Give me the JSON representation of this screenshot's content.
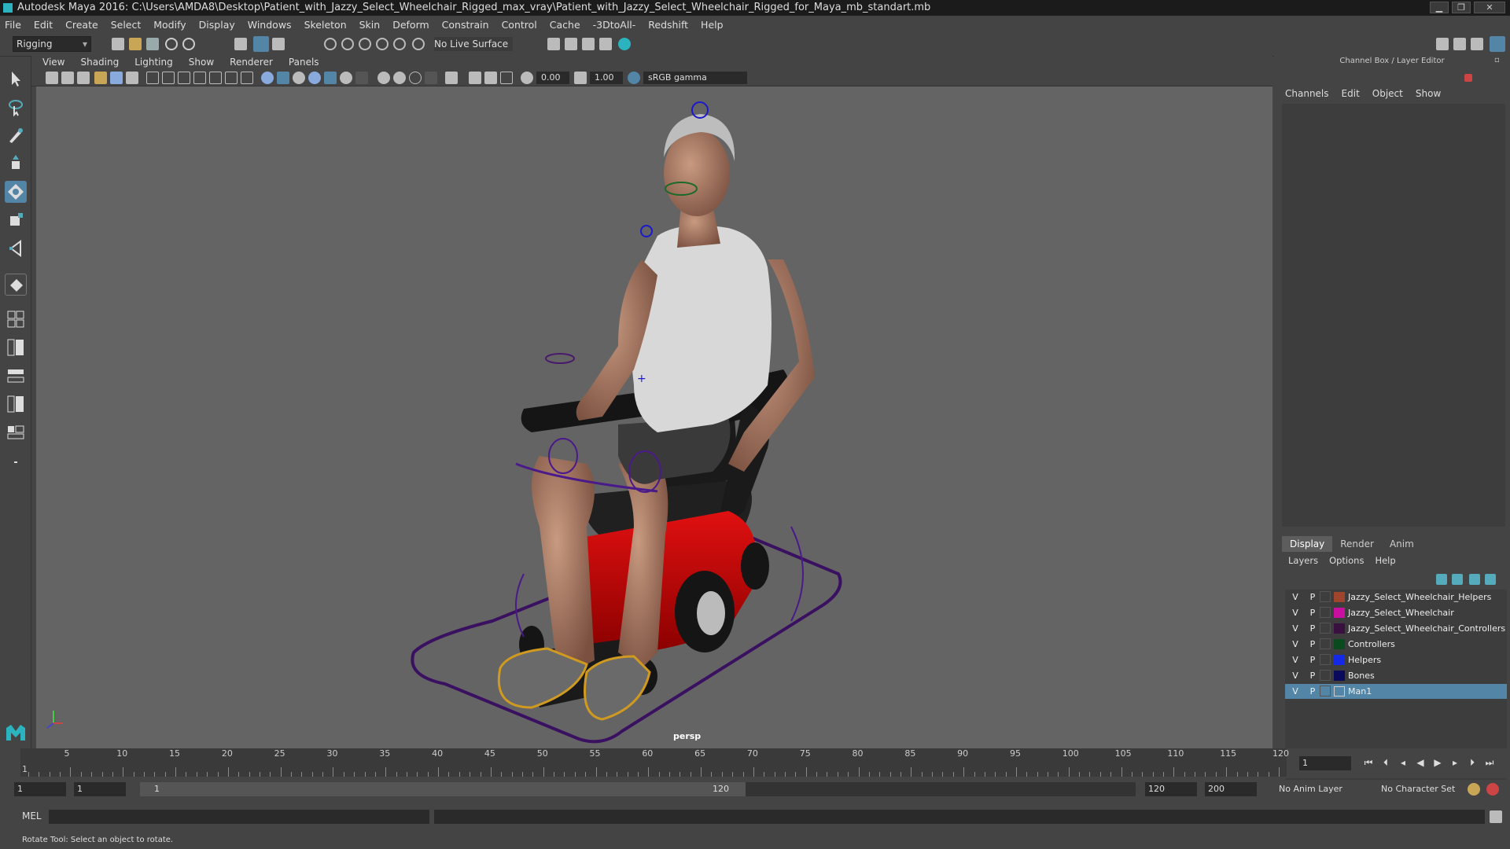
{
  "window": {
    "title": "Autodesk Maya 2016: C:\\Users\\AMDA8\\Desktop\\Patient_with_Jazzy_Select_Wheelchair_Rigged_max_vray\\Patient_with_Jazzy_Select_Wheelchair_Rigged_for_Maya_mb_standart.mb",
    "min": "▁",
    "max": "❐",
    "close": "✕"
  },
  "menubar": [
    "File",
    "Edit",
    "Create",
    "Select",
    "Modify",
    "Display",
    "Windows",
    "Skeleton",
    "Skin",
    "Deform",
    "Constrain",
    "Control",
    "Cache",
    "-3DtoAll-",
    "Redshift",
    "Help"
  ],
  "shelf": {
    "mode": "Rigging",
    "live_surface": "No Live Surface"
  },
  "viewport": {
    "menu": [
      "View",
      "Shading",
      "Lighting",
      "Show",
      "Renderer",
      "Panels"
    ],
    "near_value": "0.00",
    "far_value": "1.00",
    "color_space": "sRGB gamma",
    "camera_label": "persp"
  },
  "channel_box": {
    "title": "Channel Box / Layer Editor",
    "menu": [
      "Channels",
      "Edit",
      "Object",
      "Show"
    ]
  },
  "layer_editor": {
    "tabs": [
      "Display",
      "Render",
      "Anim"
    ],
    "menu": [
      "Layers",
      "Options",
      "Help"
    ],
    "layers": [
      {
        "v": "V",
        "p": "P",
        "name": "Jazzy_Select_Wheelchair_Helpers",
        "color": "#a0452d",
        "selected": false
      },
      {
        "v": "V",
        "p": "P",
        "name": "Jazzy_Select_Wheelchair",
        "color": "#c80fa0",
        "selected": false
      },
      {
        "v": "V",
        "p": "P",
        "name": "Jazzy_Select_Wheelchair_Controllers",
        "color": "#3a1040",
        "selected": false
      },
      {
        "v": "V",
        "p": "P",
        "name": "Controllers",
        "color": "#0a4a1e",
        "selected": false
      },
      {
        "v": "V",
        "p": "P",
        "name": "Helpers",
        "color": "#1428e6",
        "selected": false
      },
      {
        "v": "V",
        "p": "P",
        "name": "Bones",
        "color": "#0a0a5a",
        "selected": false
      },
      {
        "v": "V",
        "p": "P",
        "name": "Man1",
        "color": "#5285a6",
        "selected": true
      }
    ]
  },
  "timeline": {
    "ticks": [
      "5",
      "10",
      "15",
      "20",
      "25",
      "30",
      "35",
      "40",
      "45",
      "50",
      "55",
      "60",
      "65",
      "70",
      "75",
      "80",
      "85",
      "90",
      "95",
      "100",
      "105",
      "110",
      "115",
      "120"
    ],
    "start_label": "1",
    "current_frame": "1"
  },
  "range": {
    "start": "1",
    "range_start": "1",
    "slider_start": "1",
    "slider_end": "120",
    "range_end": "120",
    "end": "200",
    "anim_layer": "No Anim Layer",
    "char_set": "No Character Set"
  },
  "command_line": {
    "label": "MEL"
  },
  "status_line": "Rotate Tool: Select an object to rotate."
}
